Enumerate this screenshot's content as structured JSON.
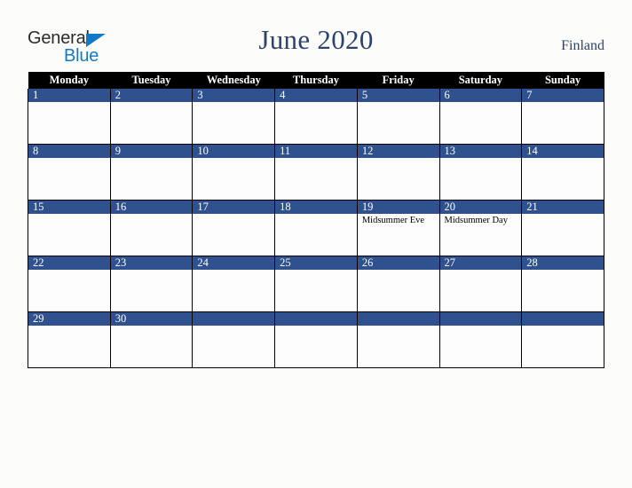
{
  "brand": {
    "word1": "General",
    "word2": "Blue",
    "triangle_color": "#1379c4",
    "word1_color": "#2b2b2b",
    "word2_color": "#1379c4"
  },
  "header": {
    "title": "June 2020",
    "country": "Finland",
    "title_color": "#2e4369"
  },
  "calendar": {
    "weekday_headers": [
      "Monday",
      "Tuesday",
      "Wednesday",
      "Thursday",
      "Friday",
      "Saturday",
      "Sunday"
    ],
    "header_bg": "#000000",
    "header_text_color": "#ffffff",
    "date_band_color": "#2f528f",
    "date_text_color": "#ffffff",
    "cell_bg": "#fdfdfd",
    "grid_color": "#000000",
    "weeks": [
      [
        {
          "date": "1",
          "event": ""
        },
        {
          "date": "2",
          "event": ""
        },
        {
          "date": "3",
          "event": ""
        },
        {
          "date": "4",
          "event": ""
        },
        {
          "date": "5",
          "event": ""
        },
        {
          "date": "6",
          "event": ""
        },
        {
          "date": "7",
          "event": ""
        }
      ],
      [
        {
          "date": "8",
          "event": ""
        },
        {
          "date": "9",
          "event": ""
        },
        {
          "date": "10",
          "event": ""
        },
        {
          "date": "11",
          "event": ""
        },
        {
          "date": "12",
          "event": ""
        },
        {
          "date": "13",
          "event": ""
        },
        {
          "date": "14",
          "event": ""
        }
      ],
      [
        {
          "date": "15",
          "event": ""
        },
        {
          "date": "16",
          "event": ""
        },
        {
          "date": "17",
          "event": ""
        },
        {
          "date": "18",
          "event": ""
        },
        {
          "date": "19",
          "event": "Midsummer Eve"
        },
        {
          "date": "20",
          "event": "Midsummer Day"
        },
        {
          "date": "21",
          "event": ""
        }
      ],
      [
        {
          "date": "22",
          "event": ""
        },
        {
          "date": "23",
          "event": ""
        },
        {
          "date": "24",
          "event": ""
        },
        {
          "date": "25",
          "event": ""
        },
        {
          "date": "26",
          "event": ""
        },
        {
          "date": "27",
          "event": ""
        },
        {
          "date": "28",
          "event": ""
        }
      ],
      [
        {
          "date": "29",
          "event": ""
        },
        {
          "date": "30",
          "event": ""
        },
        {
          "date": "",
          "event": ""
        },
        {
          "date": "",
          "event": ""
        },
        {
          "date": "",
          "event": ""
        },
        {
          "date": "",
          "event": ""
        },
        {
          "date": "",
          "event": ""
        }
      ]
    ]
  }
}
